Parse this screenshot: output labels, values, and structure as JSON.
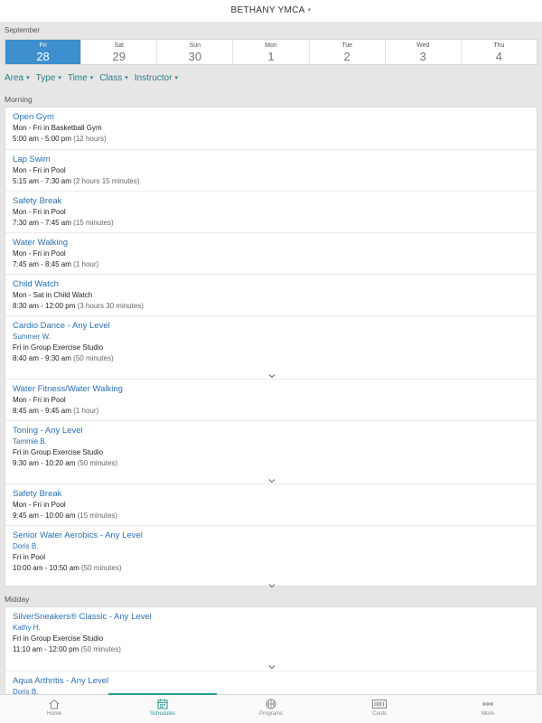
{
  "header": {
    "title": "BETHANY YMCA",
    "caret": "▾"
  },
  "month": "September",
  "days": [
    {
      "name": "Fri",
      "date": "28",
      "selected": true
    },
    {
      "name": "Sat",
      "date": "29"
    },
    {
      "name": "Sun",
      "date": "30"
    },
    {
      "name": "Mon",
      "date": "1"
    },
    {
      "name": "Tue",
      "date": "2"
    },
    {
      "name": "Wed",
      "date": "3"
    },
    {
      "name": "Thu",
      "date": "4"
    }
  ],
  "filters": [
    "Area",
    "Type",
    "Time",
    "Class",
    "Instructor"
  ],
  "sections": [
    {
      "label": "Morning",
      "items": [
        {
          "name": "Open Gym",
          "location": "Mon - Fri in Basketball Gym",
          "time": "5:00 am - 5:00 pm",
          "duration": "(12 hours)"
        },
        {
          "name": "Lap Swim",
          "location": "Mon - Fri in Pool",
          "time": "5:15 am - 7:30 am",
          "duration": "(2 hours 15 minutes)"
        },
        {
          "name": "Safety Break",
          "location": "Mon - Fri in Pool",
          "time": "7:30 am - 7:45 am",
          "duration": "(15 minutes)"
        },
        {
          "name": "Water Walking",
          "location": "Mon - Fri in Pool",
          "time": "7:45 am - 8:45 am",
          "duration": "(1 hour)"
        },
        {
          "name": "Child Watch",
          "location": "Mon - Sat in Child Watch",
          "time": "8:30 am - 12:00 pm",
          "duration": "(3 hours 30 minutes)"
        },
        {
          "name": "Cardio Dance - Any Level",
          "instructor": "Summer W.",
          "location": "Fri in Group Exercise Studio",
          "time": "8:40 am - 9:30 am",
          "duration": "(50 minutes)",
          "expandable": true
        },
        {
          "name": "Water Fitness/Water Walking",
          "location": "Mon - Fri in Pool",
          "time": "8:45 am - 9:45 am",
          "duration": "(1 hour)"
        },
        {
          "name": "Toning - Any Level",
          "instructor": "Tammie B.",
          "location": "Fri in Group Exercise Studio",
          "time": "9:30 am - 10:20 am",
          "duration": "(50 minutes)",
          "expandable": true
        },
        {
          "name": "Safety Break",
          "location": "Mon - Fri in Pool",
          "time": "9:45 am - 10:00 am",
          "duration": "(15 minutes)"
        },
        {
          "name": "Senior Water Aerobics - Any Level",
          "instructor": "Doris B.",
          "location": "Fri in Pool",
          "time": "10:00 am - 10:50 am",
          "duration": "(50 minutes)",
          "expandable": true
        }
      ]
    },
    {
      "label": "Midday",
      "items": [
        {
          "name": "SilverSneakers® Classic - Any Level",
          "instructor": "Kathy H.",
          "location": "Fri in Group Exercise Studio",
          "time": "11:10 am - 12:00 pm",
          "duration": "(50 minutes)",
          "expandable": true
        },
        {
          "name": "Aqua Arthritis - Any Level",
          "instructor": "Doris B."
        }
      ]
    }
  ],
  "tabs": [
    {
      "label": "Home",
      "icon": "home-icon"
    },
    {
      "label": "Schedules",
      "icon": "calendar-icon",
      "active": true
    },
    {
      "label": "Programs",
      "icon": "basketball-icon"
    },
    {
      "label": "Cards",
      "icon": "barcode-icon"
    },
    {
      "label": "More",
      "icon": "more-icon"
    }
  ],
  "colors": {
    "accent": "#3d8fce",
    "link": "#2a6fb5",
    "filter": "#2d7d8a",
    "tab_active": "#2a9b96"
  }
}
